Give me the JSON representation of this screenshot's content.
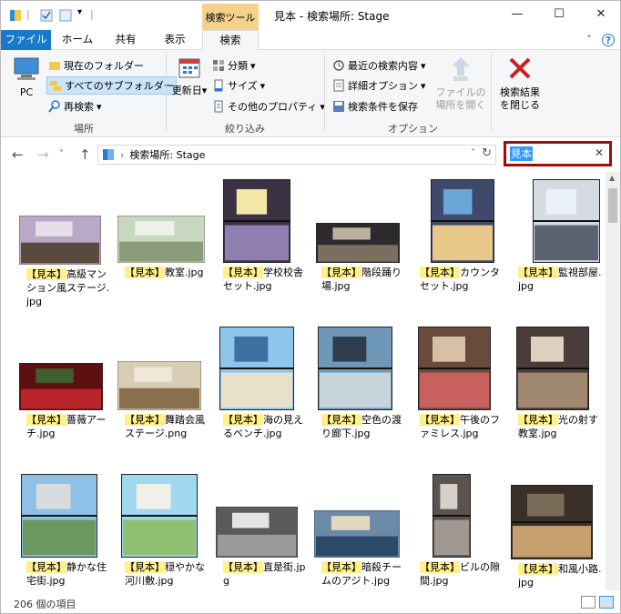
{
  "window": {
    "context_tab": "検索ツール",
    "title": "見本 - 検索場所: Stage",
    "btn_min": "—",
    "btn_max": "☐",
    "btn_close": "✕"
  },
  "tabs": {
    "file": "ファイル",
    "home": "ホーム",
    "share": "共有",
    "view": "表示",
    "search": "検索",
    "help": "?"
  },
  "ribbon": {
    "pc": "PC",
    "current_folder": "現在のフォルダー",
    "all_subfolders": "すべてのサブフォルダー",
    "research": "再検索",
    "group_location": "場所",
    "modified_date": "更新日",
    "kind": "分類",
    "size": "サイズ",
    "other_props": "その他のプロパティ",
    "group_refine": "絞り込み",
    "recent_searches": "最近の検索内容",
    "advanced_options": "詳細オプション",
    "save_search": "検索条件を保存",
    "open_location_1": "ファイルの",
    "open_location_2": "場所を開く",
    "close_search_1": "検索結果",
    "close_search_2": "を閉じる",
    "group_options": "オプション"
  },
  "address": {
    "path": "検索場所: Stage",
    "search_value": "見本"
  },
  "files": [
    {
      "tag": "【見本】",
      "name": "高級マンション風ステージ.jpg"
    },
    {
      "tag": "【見本】",
      "name": "教室.jpg"
    },
    {
      "tag": "【見本】",
      "name": "学校校舎セット.jpg"
    },
    {
      "tag": "【見本】",
      "name": "階段踊り場.jpg"
    },
    {
      "tag": "【見本】",
      "name": "カウンタセット.jpg"
    },
    {
      "tag": "【見本】",
      "name": "監視部屋.jpg"
    },
    {
      "tag": "【見本】",
      "name": "薔薇アーチ.jpg"
    },
    {
      "tag": "【見本】",
      "name": "舞踏会風ステージ.png"
    },
    {
      "tag": "【見本】",
      "name": "海の見えるベンチ.jpg"
    },
    {
      "tag": "【見本】",
      "name": "空色の渡り廊下.jpg"
    },
    {
      "tag": "【見本】",
      "name": "午後のファミレス.jpg"
    },
    {
      "tag": "【見本】",
      "name": "光の射す教室.jpg"
    },
    {
      "tag": "【見本】",
      "name": "静かな住宅街.jpg"
    },
    {
      "tag": "【見本】",
      "name": "穏やかな河川敷.jpg"
    },
    {
      "tag": "【見本】",
      "name": "直是街.jpg"
    },
    {
      "tag": "【見本】",
      "name": "暗殺チームのアジト.jpg"
    },
    {
      "tag": "【見本】",
      "name": "ビルの隙間.jpg"
    },
    {
      "tag": "【見本】",
      "name": "和風小路.jpg"
    }
  ],
  "status": {
    "count": "206 個の項目"
  },
  "colors": {
    "accent": "#1979ca",
    "context": "#f5d28c",
    "highlight": "#fff08a",
    "search_border": "#a30a0a"
  }
}
